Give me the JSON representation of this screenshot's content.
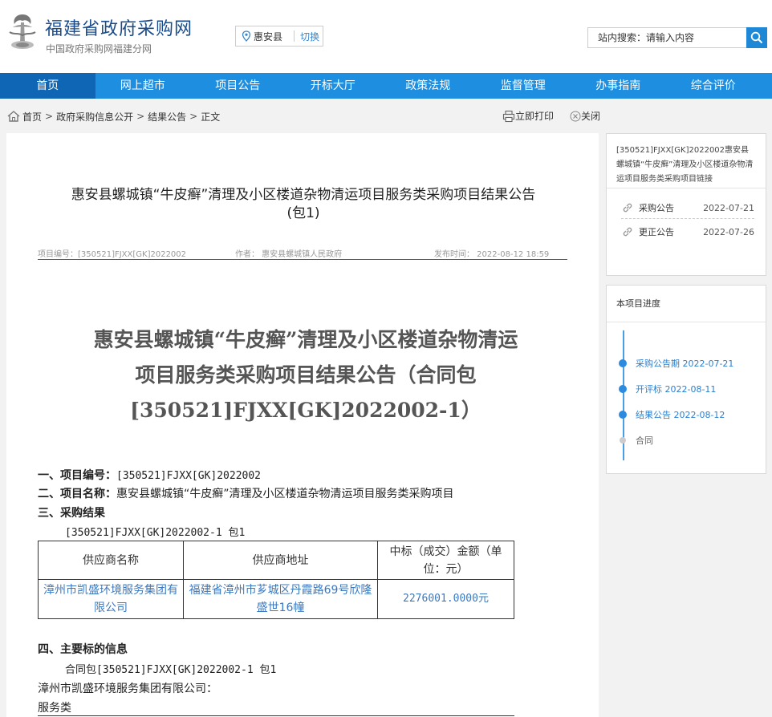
{
  "header": {
    "site_title": "福建省政府采购网",
    "site_subtitle": "中国政府采购网福建分网",
    "region": "惠安县",
    "region_switch": "切换",
    "search_placeholder": "站内搜索：请输入内容"
  },
  "nav": [
    "首页",
    "网上超市",
    "项目公告",
    "开标大厅",
    "政策法规",
    "监督管理",
    "办事指南",
    "综合评价"
  ],
  "breadcrumb": {
    "items": [
      "首页",
      "政府采购信息公开",
      "结果公告",
      "正文"
    ],
    "separator": ">"
  },
  "tools": {
    "print": "立即打印",
    "close": "关闭"
  },
  "article": {
    "title_line1": "惠安县螺城镇“牛皮癣”清理及小区楼道杂物清运项目服务类采购项目结果公告",
    "title_line2": "(包1)",
    "meta": {
      "project_no": "项目编号：[350521]FJXX[GK]2022002",
      "author": "作者：  惠安县螺城镇人民政府",
      "publish_time": "发布时间：  2022-08-12 18:59"
    },
    "doc_title_lines": [
      "惠安县螺城镇“牛皮癣”清理及小区楼道杂物清运",
      "项目服务类采购项目结果公告（合同包",
      "[350521]FJXX[GK]2022002-1）"
    ],
    "sec1_label": "一、项目编号：",
    "sec1_value": "[350521]FJXX[GK]2022002",
    "sec2_label": "二、项目名称：",
    "sec2_value": "惠安县螺城镇“牛皮癣”清理及小区楼道杂物清运项目服务类采购项目",
    "sec3_label": "三、采购结果",
    "sec3_pkg": "[350521]FJXX[GK]2022002-1 包1",
    "table": {
      "headers": [
        "供应商名称",
        "供应商地址",
        "中标（成交）金额（单位：元）"
      ],
      "row": [
        "漳州市凯盛环境服务集团有限公司",
        "福建省漳州市芗城区丹霞路69号欣隆盛世16幢",
        "2276001.0000元"
      ]
    },
    "sec4_label": "四、主要标的信息",
    "sec4_pkg": "合同包[350521]FJXX[GK]2022002-1 包1",
    "sec4_supplier": "漳州市凯盛环境服务集团有限公司：",
    "sec4_type": "服务类"
  },
  "sidebar": {
    "links_title": "[350521]FJXX[GK]2022002惠安县螺城镇“牛皮癣”清理及小区楼道杂物清运项目服务类采购项目链接",
    "links": [
      {
        "label": "采购公告",
        "date": "2022-07-21"
      },
      {
        "label": "更正公告",
        "date": "2022-07-26"
      }
    ],
    "progress_title": "本项目进度",
    "progress": [
      {
        "label": "采购公告期",
        "date": "2022-07-21",
        "done": true
      },
      {
        "label": "开评标",
        "date": "2022-08-11",
        "done": true
      },
      {
        "label": "结果公告",
        "date": "2022-08-12",
        "done": true
      },
      {
        "label": "合同",
        "date": "",
        "done": false
      }
    ]
  },
  "colors": {
    "nav_bg": "#1e8ee0",
    "nav_active": "#0f66b5",
    "title_blue": "#1a4c8c",
    "link_blue": "#3a79c0"
  }
}
